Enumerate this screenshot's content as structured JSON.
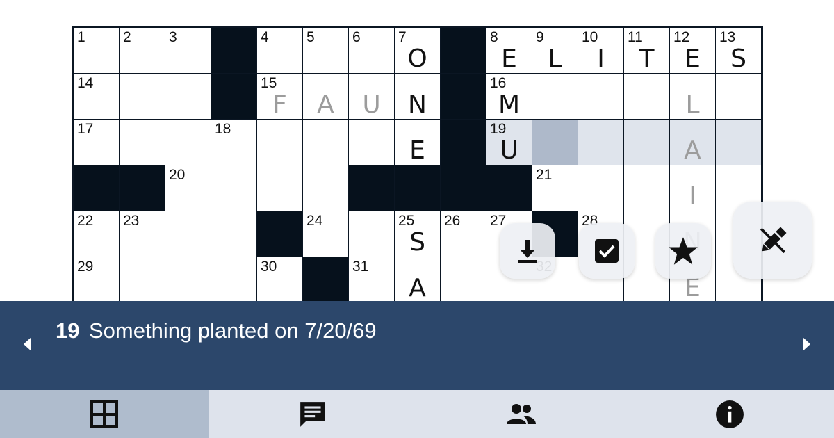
{
  "grid": {
    "rows": [
      [
        {
          "n": "1"
        },
        {
          "n": "2"
        },
        {
          "n": "3"
        },
        {
          "b": true
        },
        {
          "n": "4"
        },
        {
          "n": "5"
        },
        {
          "n": "6"
        },
        {
          "n": "7",
          "l": "O"
        },
        {
          "b": true
        },
        {
          "n": "8",
          "l": "E"
        },
        {
          "n": "9",
          "l": "L"
        },
        {
          "n": "10",
          "l": "I"
        },
        {
          "n": "11",
          "l": "T"
        },
        {
          "n": "12",
          "l": "E"
        },
        {
          "n": "13",
          "l": "S"
        }
      ],
      [
        {
          "n": "14"
        },
        {},
        {},
        {
          "b": true
        },
        {
          "n": "15",
          "l": "F",
          "p": true
        },
        {
          "l": "A",
          "p": true
        },
        {
          "l": "U",
          "p": true
        },
        {
          "l": "N"
        },
        {
          "b": true
        },
        {
          "n": "16",
          "l": "M"
        },
        {},
        {},
        {},
        {
          "l": "L",
          "p": true
        },
        {}
      ],
      [
        {
          "n": "17"
        },
        {},
        {},
        {
          "n": "18"
        },
        {},
        {},
        {},
        {
          "l": "E"
        },
        {
          "b": true
        },
        {
          "n": "19",
          "l": "U",
          "h": true
        },
        {
          "s": true
        },
        {
          "h": true
        },
        {
          "h": true
        },
        {
          "l": "A",
          "p": true,
          "h": true
        },
        {
          "h": true
        }
      ],
      [
        {
          "b": true
        },
        {
          "b": true
        },
        {
          "n": "20"
        },
        {},
        {},
        {},
        {
          "b": true
        },
        {
          "b": true
        },
        {
          "b": true
        },
        {
          "b": true
        },
        {
          "n": "21"
        },
        {},
        {},
        {
          "l": "I",
          "p": true
        },
        {}
      ],
      [
        {
          "n": "22"
        },
        {
          "n": "23"
        },
        {},
        {},
        {
          "b": true
        },
        {
          "n": "24"
        },
        {},
        {
          "n": "25",
          "l": "S"
        },
        {
          "n": "26"
        },
        {
          "n": "27"
        },
        {
          "b": true
        },
        {
          "n": "28"
        },
        {},
        {
          "l": "N",
          "p": true
        },
        {}
      ],
      [
        {
          "n": "29"
        },
        {},
        {},
        {},
        {
          "n": "30"
        },
        {
          "b": true
        },
        {
          "n": "31"
        },
        {
          "l": "A"
        },
        {},
        {},
        {
          "n": "32"
        },
        {},
        {},
        {
          "l": "E",
          "p": true
        },
        {}
      ]
    ]
  },
  "toolbar": {
    "download_icon": "download-icon",
    "check_icon": "check-box-icon",
    "star_icon": "star-icon",
    "pencil_icon": "pencil-icon"
  },
  "clue": {
    "number": "19",
    "text": "Something planted on 7/20/69"
  },
  "tabs": [
    {
      "name": "grid-icon",
      "active": true
    },
    {
      "name": "chat-icon",
      "active": false
    },
    {
      "name": "people-icon",
      "active": false
    },
    {
      "name": "info-icon",
      "active": false
    }
  ],
  "colors": {
    "clue_bar": "#2c476b",
    "selected_cell": "#aeb9ca",
    "highlight_cell": "#dfe4ec",
    "tab_active": "#afbccd",
    "tab_bar": "#dee3ec"
  }
}
